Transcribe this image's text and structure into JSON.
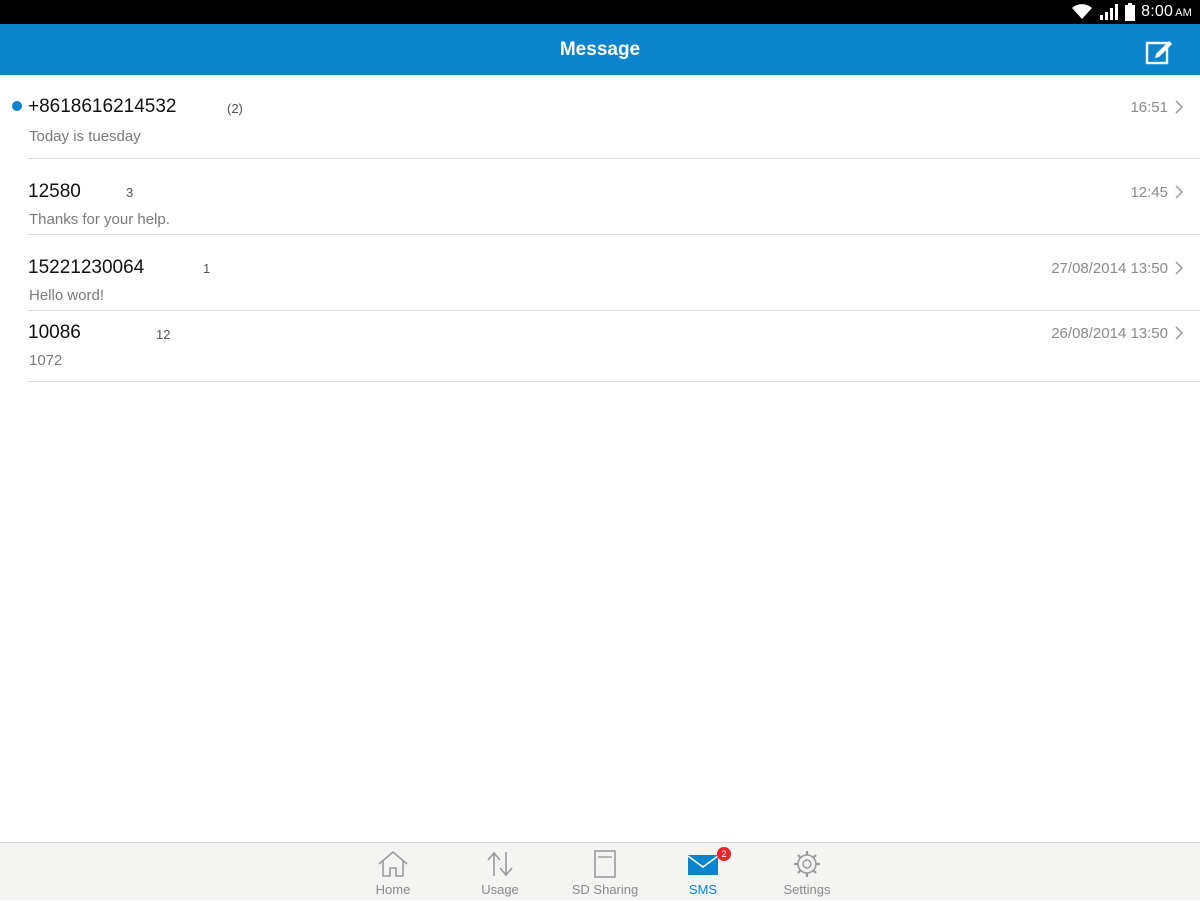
{
  "status_bar": {
    "time": "8:00",
    "ampm": "AM",
    "icons": [
      "wifi-icon",
      "signal-icon",
      "battery-icon"
    ]
  },
  "header": {
    "title": "Message",
    "compose_icon": "compose-icon"
  },
  "colors": {
    "accent": "#0a84cc",
    "badge": "#e8262a"
  },
  "messages": [
    {
      "sender": "+8618616214532",
      "count": "(2)",
      "preview": "Today is tuesday",
      "time": "16:51",
      "unread": true
    },
    {
      "sender": "12580",
      "count": "3",
      "preview": "Thanks for your help.",
      "time": "12:45",
      "unread": false
    },
    {
      "sender": "15221230064",
      "count": "1",
      "preview": "Hello word!",
      "time": "27/08/2014  13:50",
      "unread": false
    },
    {
      "sender": "10086",
      "count": "12",
      "preview": "1072",
      "time": "26/08/2014  13:50",
      "unread": false
    }
  ],
  "tabs": [
    {
      "label": "Home",
      "icon": "home-icon",
      "active": false
    },
    {
      "label": "Usage",
      "icon": "usage-arrows-icon",
      "active": false
    },
    {
      "label": "SD Sharing",
      "icon": "sd-card-icon",
      "active": false
    },
    {
      "label": "SMS",
      "icon": "envelope-icon",
      "active": true,
      "badge": "2"
    },
    {
      "label": "Settings",
      "icon": "gear-icon",
      "active": false
    }
  ]
}
